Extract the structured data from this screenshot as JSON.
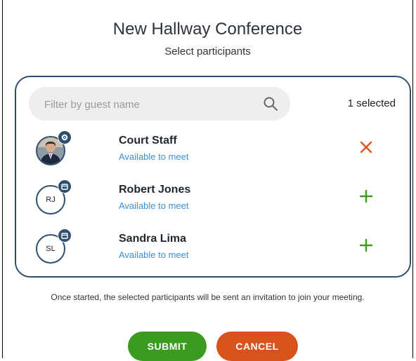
{
  "dialog": {
    "title": "New Hallway Conference",
    "subtitle": "Select participants"
  },
  "filter": {
    "placeholder": "Filter by guest name",
    "value": "",
    "icon": "search-icon"
  },
  "selection": {
    "count_label": "1 selected"
  },
  "participants": [
    {
      "name": "Court Staff",
      "status": "Available to meet",
      "initials": "",
      "avatar": "photo",
      "badge_icon": "gear-icon",
      "action": "remove",
      "action_icon": "close-icon"
    },
    {
      "name": "Robert Jones",
      "status": "Available to meet",
      "initials": "RJ",
      "avatar": "initials",
      "badge_icon": "calendar-icon",
      "action": "add",
      "action_icon": "plus-icon"
    },
    {
      "name": "Sandra Lima",
      "status": "Available to meet",
      "initials": "SL",
      "avatar": "initials",
      "badge_icon": "calendar-icon",
      "action": "add",
      "action_icon": "plus-icon"
    }
  ],
  "footnote": "Once started, the selected participants will be sent an invitation to join your meeting.",
  "buttons": {
    "submit": "SUBMIT",
    "cancel": "CANCEL"
  },
  "colors": {
    "accent": "#2f4f6e",
    "status_link": "#3c8fd6",
    "remove": "#e0531f",
    "add": "#3a9b1f",
    "submit": "#3a9b1f",
    "cancel": "#d8531b"
  }
}
